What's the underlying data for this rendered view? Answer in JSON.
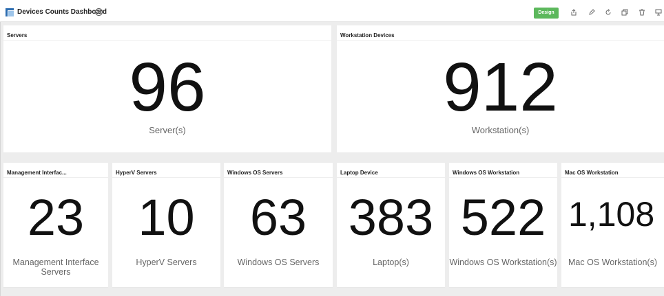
{
  "header": {
    "title": "Devices Counts Dashboard",
    "help_symbol": "?",
    "design_label": "Design",
    "accent_color": "#5cb85c",
    "toolbar_icons": [
      "share-icon",
      "edit-icon",
      "refresh-icon",
      "copy-icon",
      "delete-icon",
      "present-icon"
    ]
  },
  "widgets": [
    {
      "title": "Servers",
      "value": "96",
      "caption": "Server(s)"
    },
    {
      "title": "Workstation Devices",
      "value": "912",
      "caption": "Workstation(s)"
    },
    {
      "title": "Management Interfac...",
      "value": "23",
      "caption": "Management Interface Servers"
    },
    {
      "title": "HyperV Servers",
      "value": "10",
      "caption": "HyperV Servers"
    },
    {
      "title": "Windows OS Servers",
      "value": "63",
      "caption": "Windows OS Servers"
    },
    {
      "title": "Laptop Device",
      "value": "383",
      "caption": "Laptop(s)"
    },
    {
      "title": "Windows OS Workstation",
      "value": "522",
      "caption": "Windows OS Workstation(s)"
    },
    {
      "title": "Mac OS Workstation",
      "value": "1,108",
      "caption": "Mac OS Workstation(s)"
    }
  ]
}
